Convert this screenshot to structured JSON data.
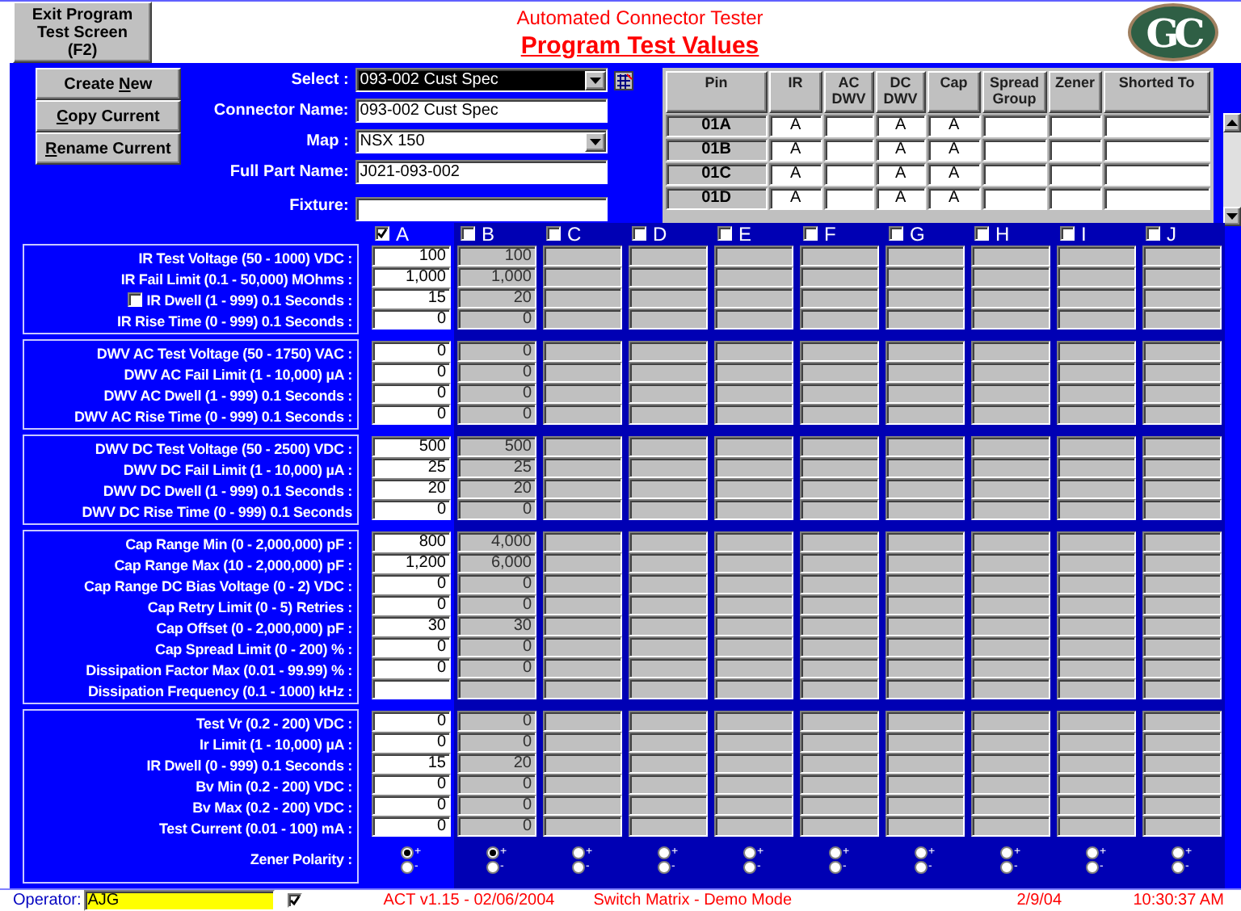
{
  "header": {
    "exit_button": "Exit Program Test Screen (F2)",
    "title": "Automated Connector Tester",
    "subtitle": "Program Test Values",
    "logo": "GC"
  },
  "actions": [
    {
      "before": "Create ",
      "key": "N",
      "after": "ew"
    },
    {
      "key": "C",
      "after": "opy Current"
    },
    {
      "key": "R",
      "after": "ename Current"
    }
  ],
  "form": [
    {
      "label": "Select :",
      "value": "093-002 Cust Spec",
      "kind": "dropdown",
      "selected": true
    },
    {
      "label": "Connector Name:",
      "value": "093-002 Cust Spec",
      "kind": "text",
      "selected": false
    },
    {
      "label": "Map :",
      "value": "NSX 150",
      "kind": "dropdown",
      "selected": false
    },
    {
      "label": "Full Part Name:",
      "value": "J021-093-002",
      "kind": "text",
      "selected": false
    },
    {
      "label": "Fixture:",
      "kind": "text",
      "selected": false
    }
  ],
  "pin_table": {
    "columns": [
      "Pin",
      "IR",
      "AC DWV",
      "DC DWV",
      "Cap",
      "Spread Group",
      "Zener",
      "Shorted To"
    ],
    "rows": [
      {
        "cells": [
          "01A",
          "A",
          null,
          "A",
          "A",
          null,
          null,
          null
        ]
      },
      {
        "cells": [
          "01B",
          "A",
          null,
          "A",
          "A",
          null,
          null,
          null
        ]
      },
      {
        "cells": [
          "01C",
          "A",
          null,
          "A",
          "A",
          null,
          null,
          null
        ]
      },
      {
        "cells": [
          "01D",
          "A",
          null,
          "A",
          "A",
          null,
          null,
          null
        ]
      }
    ]
  },
  "test_columns": [
    {
      "letter": "A",
      "checked": true,
      "editable": true,
      "polarity": [
        {
          "label": "+",
          "selected": true
        },
        {
          "label": "-",
          "selected": false
        }
      ]
    },
    {
      "letter": "B",
      "checked": false,
      "editable": false,
      "polarity": [
        {
          "label": "+",
          "selected": true
        },
        {
          "label": "-",
          "selected": false
        }
      ]
    },
    {
      "letter": "C",
      "checked": false,
      "editable": false,
      "polarity": [
        {
          "label": "+",
          "selected": false
        },
        {
          "label": "-",
          "selected": false
        }
      ]
    },
    {
      "letter": "D",
      "checked": false,
      "editable": false,
      "polarity": [
        {
          "label": "+",
          "selected": false
        },
        {
          "label": "-",
          "selected": false
        }
      ]
    },
    {
      "letter": "E",
      "checked": false,
      "editable": false,
      "polarity": [
        {
          "label": "+",
          "selected": false
        },
        {
          "label": "-",
          "selected": false
        }
      ]
    },
    {
      "letter": "F",
      "checked": false,
      "editable": false,
      "polarity": [
        {
          "label": "+",
          "selected": false
        },
        {
          "label": "-",
          "selected": false
        }
      ]
    },
    {
      "letter": "G",
      "checked": false,
      "editable": false,
      "polarity": [
        {
          "label": "+",
          "selected": false
        },
        {
          "label": "-",
          "selected": false
        }
      ]
    },
    {
      "letter": "H",
      "checked": false,
      "editable": false,
      "polarity": [
        {
          "label": "+",
          "selected": false
        },
        {
          "label": "-",
          "selected": false
        }
      ]
    },
    {
      "letter": "I",
      "checked": false,
      "editable": false,
      "polarity": [
        {
          "label": "+",
          "selected": false
        },
        {
          "label": "-",
          "selected": false
        }
      ]
    },
    {
      "letter": "J",
      "checked": false,
      "editable": false,
      "polarity": [
        {
          "label": "+",
          "selected": false
        },
        {
          "label": "-",
          "selected": false
        }
      ]
    }
  ],
  "sections": [
    {
      "rows": [
        {
          "label": "IR Test Voltage (50 - 1000) VDC :",
          "values": [
            "100",
            "100"
          ]
        },
        {
          "label": "IR Fail Limit (0.1 - 50,000) MOhms :",
          "values": [
            "1,000",
            "1,000"
          ]
        },
        {
          "label": "IR Dwell (1 - 999) 0.1 Seconds :",
          "values": [
            "15",
            "20"
          ],
          "kind": "checkbox",
          "checked": false
        },
        {
          "label": "IR Rise Time (0 - 999) 0.1 Seconds :",
          "values": [
            "0",
            "0"
          ]
        }
      ]
    },
    {
      "rows": [
        {
          "label": "DWV AC Test Voltage (50 - 1750) VAC :",
          "values": [
            "0",
            "0"
          ]
        },
        {
          "label": "DWV AC Fail Limit (1 - 10,000) µA :",
          "values": [
            "0",
            "0"
          ]
        },
        {
          "label": "DWV AC Dwell (1 - 999) 0.1 Seconds :",
          "values": [
            "0",
            "0"
          ]
        },
        {
          "label": "DWV AC Rise Time (0 - 999) 0.1 Seconds :",
          "values": [
            "0",
            "0"
          ]
        }
      ]
    },
    {
      "rows": [
        {
          "label": "DWV DC Test Voltage (50 - 2500) VDC :",
          "values": [
            "500",
            "500"
          ]
        },
        {
          "label": "DWV DC Fail Limit (1 - 10,000) µA :",
          "values": [
            "25",
            "25"
          ]
        },
        {
          "label": "DWV DC Dwell (1 - 999) 0.1 Seconds :",
          "values": [
            "20",
            "20"
          ]
        },
        {
          "label": "DWV DC Rise Time (0 - 999) 0.1 Seconds",
          "values": [
            "0",
            "0"
          ]
        }
      ]
    },
    {
      "rows": [
        {
          "label": "Cap Range Min (0 - 2,000,000) pF :",
          "values": [
            "800",
            "4,000"
          ]
        },
        {
          "label": "Cap Range Max (10 - 2,000,000) pF :",
          "values": [
            "1,200",
            "6,000"
          ]
        },
        {
          "label": "Cap Range DC Bias Voltage (0 - 2) VDC :",
          "values": [
            "0",
            "0"
          ]
        },
        {
          "label": "Cap Retry Limit (0 - 5) Retries :",
          "values": [
            "0",
            "0"
          ]
        },
        {
          "label": "Cap Offset (0 - 2,000,000) pF :",
          "values": [
            "30",
            "30"
          ]
        },
        {
          "label": "Cap Spread Limit (0 - 200) % :",
          "values": [
            "0",
            "0"
          ]
        },
        {
          "label": "Dissipation Factor Max (0.01 - 99.99) % :",
          "values": [
            "0",
            "0"
          ]
        },
        {
          "label": "Dissipation Frequency (0.1 - 1000) kHz :",
          "values": []
        }
      ]
    },
    {
      "rows": [
        {
          "label": "Test Vr (0.2 - 200) VDC :",
          "values": [
            "0",
            "0"
          ]
        },
        {
          "label": "Ir Limit (1 - 10,000)  µA :",
          "values": [
            "0",
            "0"
          ]
        },
        {
          "label": "IR Dwell (0 - 999) 0.1 Seconds :",
          "values": [
            "15",
            "20"
          ]
        },
        {
          "label": "Bv Min (0.2 - 200) VDC :",
          "values": [
            "0",
            "0"
          ]
        },
        {
          "label": "Bv Max (0.2 - 200) VDC :",
          "values": [
            "0",
            "0"
          ]
        },
        {
          "label": "Test Current (0.01 - 100) mA :",
          "values": [
            "0",
            "0"
          ]
        }
      ],
      "polarity_label": "Zener Polarity :"
    }
  ],
  "status_bar": {
    "operator_label": "Operator:",
    "operator": "AJG",
    "operator_checked": true,
    "version": "ACT v1.15 - 02/06/2004",
    "mode": "Switch Matrix - Demo Mode",
    "date": "2/9/04",
    "time": "10:30:37 AM"
  }
}
